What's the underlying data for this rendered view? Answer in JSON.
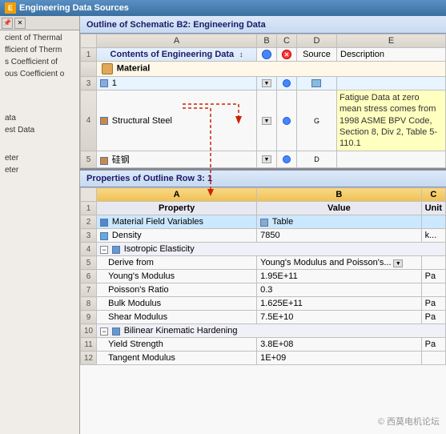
{
  "titleBar": {
    "title": "Engineering Data Sources",
    "icon": "E"
  },
  "topSection": {
    "header": "Outline of Schematic B2: Engineering Data",
    "columns": {
      "A": "A",
      "B": "B",
      "C": "C",
      "D": "D",
      "E": "E"
    },
    "colALabel": "Contents of Engineering Data",
    "colDLabel": "Source",
    "colELabel": "Description",
    "rows": [
      {
        "num": "1",
        "a": "Contents of Engineering Data",
        "isHeader": true
      },
      {
        "num": "",
        "a": "Material",
        "isMaterialHeader": true
      },
      {
        "num": "3",
        "a": "1",
        "isSelected": true
      },
      {
        "num": "4",
        "a": "Structural Steel",
        "tooltip": "Fatigue Data at zero mean stress comes from 1998 ASME BPV Code, Section 8, Div 2, Table 5-110.1"
      },
      {
        "num": "5",
        "a": "硅钢"
      }
    ]
  },
  "bottomSection": {
    "header": "Properties of Outline Row 3: 1",
    "columns": {
      "A": "A",
      "B": "B",
      "C": "C"
    },
    "colALabel": "Property",
    "colBLabel": "Value",
    "colCLabel": "Unit",
    "rows": [
      {
        "num": "1",
        "a": "Property",
        "b": "Value",
        "c": "Unit",
        "isHeader": true
      },
      {
        "num": "2",
        "a": "Material Field Variables",
        "b": "Table",
        "isSelected": true
      },
      {
        "num": "3",
        "a": "Density",
        "b": "7850",
        "c": "k..."
      },
      {
        "num": "4",
        "a": "Isotropic Elasticity",
        "hasExpand": true,
        "isGroup": true
      },
      {
        "num": "5",
        "a": "Derive from",
        "b": "Young's Modulus and Poisson's...",
        "hasDropdown": true,
        "indent": true
      },
      {
        "num": "6",
        "a": "Young's Modulus",
        "b": "1.95E+11",
        "c": "Pa",
        "indent": true
      },
      {
        "num": "7",
        "a": "Poisson's Ratio",
        "b": "0.3",
        "indent": true
      },
      {
        "num": "8",
        "a": "Bulk Modulus",
        "b": "1.625E+11",
        "c": "Pa",
        "indent": true
      },
      {
        "num": "9",
        "a": "Shear Modulus",
        "b": "7.5E+10",
        "c": "Pa",
        "indent": true
      },
      {
        "num": "10",
        "a": "Bilinear Kinematic Hardening",
        "hasExpand": true,
        "isGroup": true
      },
      {
        "num": "11",
        "a": "Yield Strength",
        "b": "3.8E+08",
        "c": "Pa",
        "indent": true
      },
      {
        "num": "12",
        "a": "Tangent Modulus",
        "b": "1E+09",
        "indent": true
      }
    ]
  },
  "leftPanel": {
    "items": [
      "cient of Thermal",
      "fficient of Therm",
      "s Coefficient of",
      "ous Coefficient o"
    ],
    "bottomItems": [
      "ata",
      "est Data"
    ],
    "bottomItems2": [
      "eter",
      "eter"
    ]
  },
  "watermark": "© 西莫电机论坛"
}
